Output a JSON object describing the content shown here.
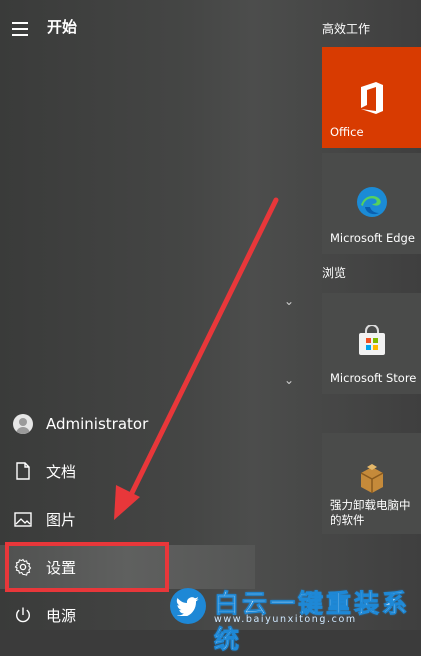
{
  "header": {
    "title": "开始"
  },
  "left_items": [
    {
      "label": "Administrator",
      "icon": "user-avatar-icon"
    },
    {
      "label": "文档",
      "icon": "document-icon"
    },
    {
      "label": "图片",
      "icon": "picture-icon"
    },
    {
      "label": "设置",
      "icon": "gear-icon"
    },
    {
      "label": "电源",
      "icon": "power-icon"
    }
  ],
  "groups": [
    {
      "label": "高效工作"
    },
    {
      "label": "浏览"
    }
  ],
  "tiles": [
    {
      "name": "Office",
      "icon": "office-icon",
      "color": "#d83b01"
    },
    {
      "name": "Microsoft Edge",
      "icon": "edge-icon",
      "color": "#4a4b4a"
    },
    {
      "name": "Microsoft Store",
      "icon": "store-icon",
      "color": "#4a4b4a"
    },
    {
      "name": "强力卸载电脑中的软件",
      "icon": "uninstall-box-icon",
      "color": "#4a4b4a"
    }
  ],
  "accent": {
    "highlight": "#e8373a",
    "office": "#d83b01",
    "watermark": "#1e88d6"
  },
  "watermark": {
    "text": "白云一键重装系统",
    "url": "www.baiyunxitong.com"
  }
}
